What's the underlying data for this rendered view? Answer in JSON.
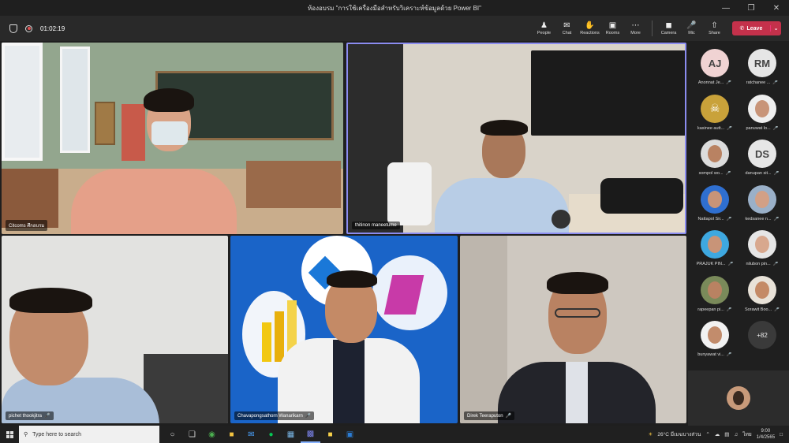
{
  "window": {
    "title": "ห้องอบรม \"การใช้เครื่องมือสำหรับวิเคราะห์ข้อมูลด้วย Power BI\""
  },
  "meeting": {
    "timer": "01:02:19"
  },
  "toolbar": {
    "people": "People",
    "chat": "Chat",
    "reactions": "Reactions",
    "rooms": "Rooms",
    "more": "More",
    "camera": "Camera",
    "mic": "Mic",
    "share": "Share",
    "leave": "Leave"
  },
  "tiles": {
    "t1": "Citcoms ศึกอบรม",
    "t2": "thitinon maneetume",
    "t3": "pichet thookjitra",
    "t4": "Chavapongsathorn Wanarikarn",
    "t5": "Direk Teeraputon"
  },
  "roster": {
    "p1": {
      "initials": "AJ",
      "name": "Anonnat Je..."
    },
    "p2": {
      "initials": "RM",
      "name": "ratchanee ..."
    },
    "p3": {
      "name": "kasinee autt..."
    },
    "p4": {
      "name": "panuwat lo..."
    },
    "p5": {
      "name": "sompol wo..."
    },
    "p6": {
      "initials": "DS",
      "name": "danupan sit..."
    },
    "p7": {
      "name": "Nattapol Sir..."
    },
    "p8": {
      "name": "kedsanee n..."
    },
    "p9": {
      "name": "PRAJUK PIN..."
    },
    "p10": {
      "name": "nilubon pin..."
    },
    "p11": {
      "name": "rapeepan pi..."
    },
    "p12": {
      "name": "Sorawit Boo..."
    },
    "p13": {
      "name": "bunyawat vi..."
    },
    "more": "+82"
  },
  "taskbar": {
    "search_placeholder": "Type here to search",
    "weather": "26°C  มีเมฆบางส่วน",
    "lang": "ไทย",
    "time": "9:00",
    "date": "1/4/2565"
  },
  "colors": {
    "leave": "#c4314b",
    "toolbar": "#292929",
    "accent": "#88b3ff"
  }
}
